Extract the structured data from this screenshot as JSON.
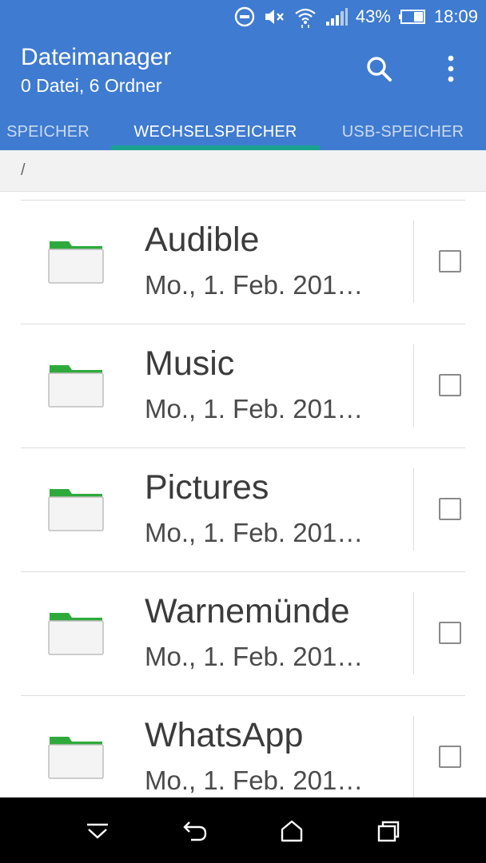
{
  "status_bar": {
    "battery_percent": "43%",
    "time": "18:09",
    "icons": [
      "dnd-icon",
      "mute-icon",
      "wifi-icon",
      "signal-icon",
      "battery-icon"
    ]
  },
  "app_bar": {
    "title": "Dateimanager",
    "subtitle": "0 Datei, 6 Ordner",
    "icons": [
      "search-icon",
      "overflow-menu-icon"
    ]
  },
  "tabs": [
    {
      "label": "SPEICHER",
      "active": false
    },
    {
      "label": "WECHSELSPEICHER",
      "active": true
    },
    {
      "label": "USB-SPEICHER",
      "active": false
    }
  ],
  "breadcrumb": {
    "path": "/"
  },
  "files": [
    {
      "name": "Audible",
      "date": "Mo., 1. Feb. 201…",
      "checked": false
    },
    {
      "name": "Music",
      "date": "Mo., 1. Feb. 201…",
      "checked": false
    },
    {
      "name": "Pictures",
      "date": "Mo., 1. Feb. 201…",
      "checked": false
    },
    {
      "name": "Warnemünde",
      "date": "Mo., 1. Feb. 201…",
      "checked": false
    },
    {
      "name": "WhatsApp",
      "date": "Mo., 1. Feb. 201…",
      "checked": false
    }
  ],
  "nav_bar": {
    "icons": [
      "hide-nav-icon",
      "back-icon",
      "home-icon",
      "recents-icon"
    ]
  },
  "colors": {
    "accent": "#3f7bd0",
    "tab_indicator": "#1aa190",
    "folder_green": "#2eaa3c"
  }
}
